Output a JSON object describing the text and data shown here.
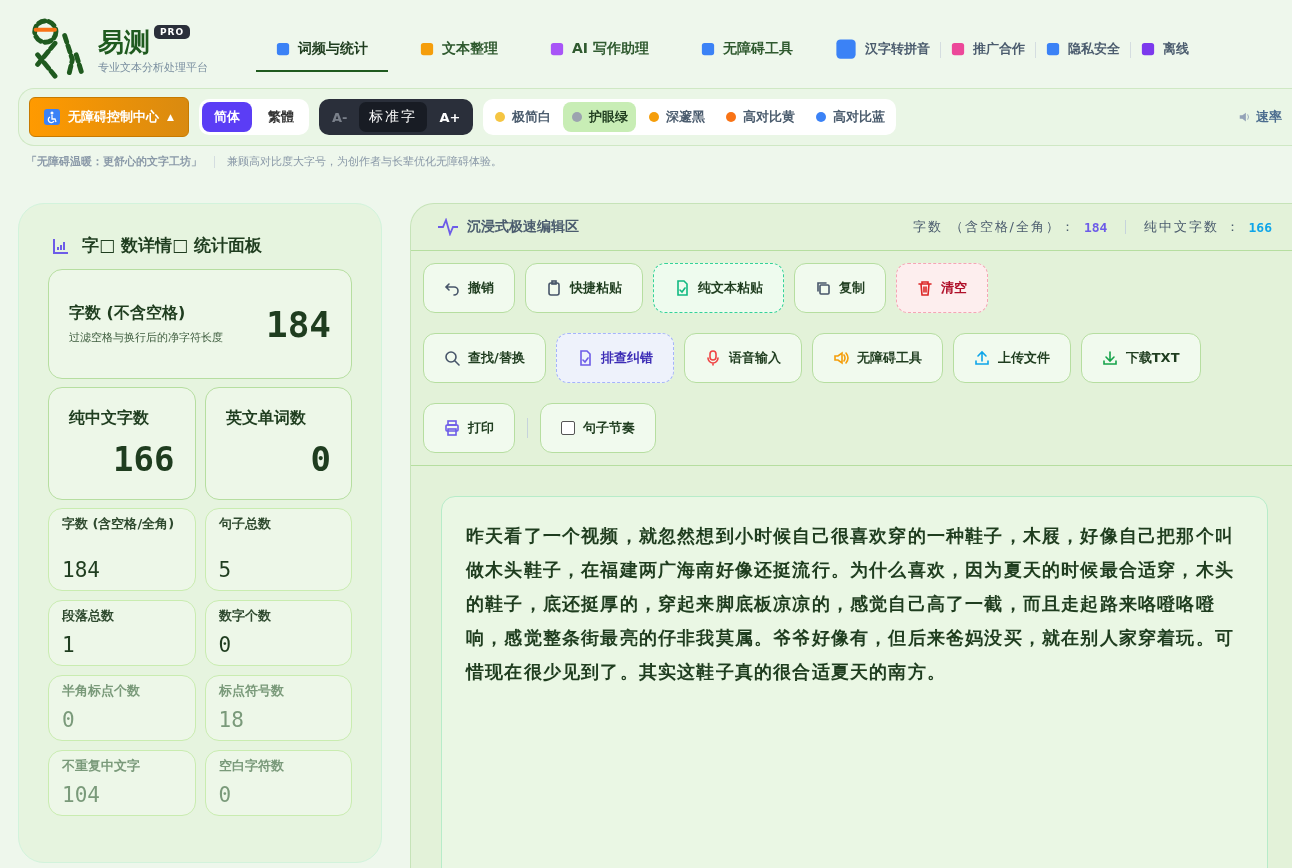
{
  "brand": {
    "name": "易测",
    "badge": "PRO",
    "subtitle": "专业文本分析处理平台"
  },
  "nav": [
    {
      "label": "词频与统计",
      "selected": true
    },
    {
      "label": "文本整理",
      "selected": false
    },
    {
      "label": "AI 写作助理",
      "selected": false
    },
    {
      "label": "无障碍工具",
      "selected": false
    },
    {
      "label": "汉字转拼音",
      "selected": false
    },
    {
      "label": "推广合作",
      "selected": false
    },
    {
      "label": "隐私安全",
      "selected": false
    },
    {
      "label": "离线",
      "selected": false
    }
  ],
  "controls": {
    "access_button": "无障碍控制中心",
    "caret": "▲",
    "scripts": [
      {
        "label": "简体",
        "selected": true
      },
      {
        "label": "繁體",
        "selected": false
      }
    ],
    "font": {
      "minus": "A-",
      "label": "标准字",
      "plus": "A+"
    },
    "themes": [
      {
        "label": "极简白",
        "selected": false
      },
      {
        "label": "护眼绿",
        "selected": true
      },
      {
        "label": "深邃黑",
        "selected": false
      },
      {
        "label": "高对比黄",
        "selected": false
      },
      {
        "label": "高对比蓝",
        "selected": false
      }
    ],
    "speed": "速率"
  },
  "tagline": {
    "title": "「无障碍温暖：更舒心的文字工坊」",
    "text": "兼顾高对比度大字号，为创作者与长辈优化无障碍体验。"
  },
  "stats": {
    "title": "字□ 数详情□ 统计面板",
    "main": {
      "label": "字数 (不含空格)",
      "hint": "过滤空格与换行后的净字符长度",
      "value": "184"
    },
    "pair": [
      {
        "label": "纯中文字数",
        "value": "166"
      },
      {
        "label": "英文单词数",
        "value": "0"
      }
    ],
    "small": [
      {
        "label": "字数 (含空格/全角)",
        "value": "184",
        "dim": false
      },
      {
        "label": "句子总数",
        "value": "5",
        "dim": false
      },
      {
        "label": "段落总数",
        "value": "1",
        "dim": false
      },
      {
        "label": "数字个数",
        "value": "0",
        "dim": false
      },
      {
        "label": "半角标点个数",
        "value": "0",
        "dim": true
      },
      {
        "label": "标点符号数",
        "value": "18",
        "dim": true
      },
      {
        "label": "不重复中文字",
        "value": "104",
        "dim": true
      },
      {
        "label": "空白字符数",
        "value": "0",
        "dim": true
      }
    ]
  },
  "editor": {
    "title": "沉浸式极速编辑区",
    "count_label": "字数 （含空格/全角）：",
    "count": "184",
    "cn_label": "纯中文字数 ：",
    "cn": "166",
    "buttons": [
      {
        "label": "撤销",
        "kind": "plain"
      },
      {
        "label": "快捷粘贴",
        "kind": "plain"
      },
      {
        "label": "纯文本粘贴",
        "kind": "green"
      },
      {
        "label": "复制",
        "kind": "plain"
      },
      {
        "label": "清空",
        "kind": "danger"
      },
      {
        "label": "查找/替换",
        "kind": "plain"
      },
      {
        "label": "排查纠错",
        "kind": "purple"
      },
      {
        "label": "语音输入",
        "kind": "plain"
      },
      {
        "label": "无障碍工具",
        "kind": "plain"
      },
      {
        "label": "上传文件",
        "kind": "plain"
      },
      {
        "label": "下载TXT",
        "kind": "plain"
      },
      {
        "label": "打印",
        "kind": "plain"
      }
    ],
    "rhythm": {
      "label": "句子节奏",
      "checked": false
    },
    "text": "昨天看了一个视频，就忽然想到小时候自己很喜欢穿的一种鞋子，木屐，好像自己把那个叫做木头鞋子，在福建两广海南好像还挺流行。为什么喜欢，因为夏天的时候最合适穿，木头的鞋子，底还挺厚的，穿起来脚底板凉凉的，感觉自己高了一截，而且走起路来咯噔咯噔响，感觉整条街最亮的仔非我莫属。爷爷好像有，但后来爸妈没买，就在别人家穿着玩。可惜现在很少见到了。其实这鞋子真的很合适夏天的南方。"
  }
}
